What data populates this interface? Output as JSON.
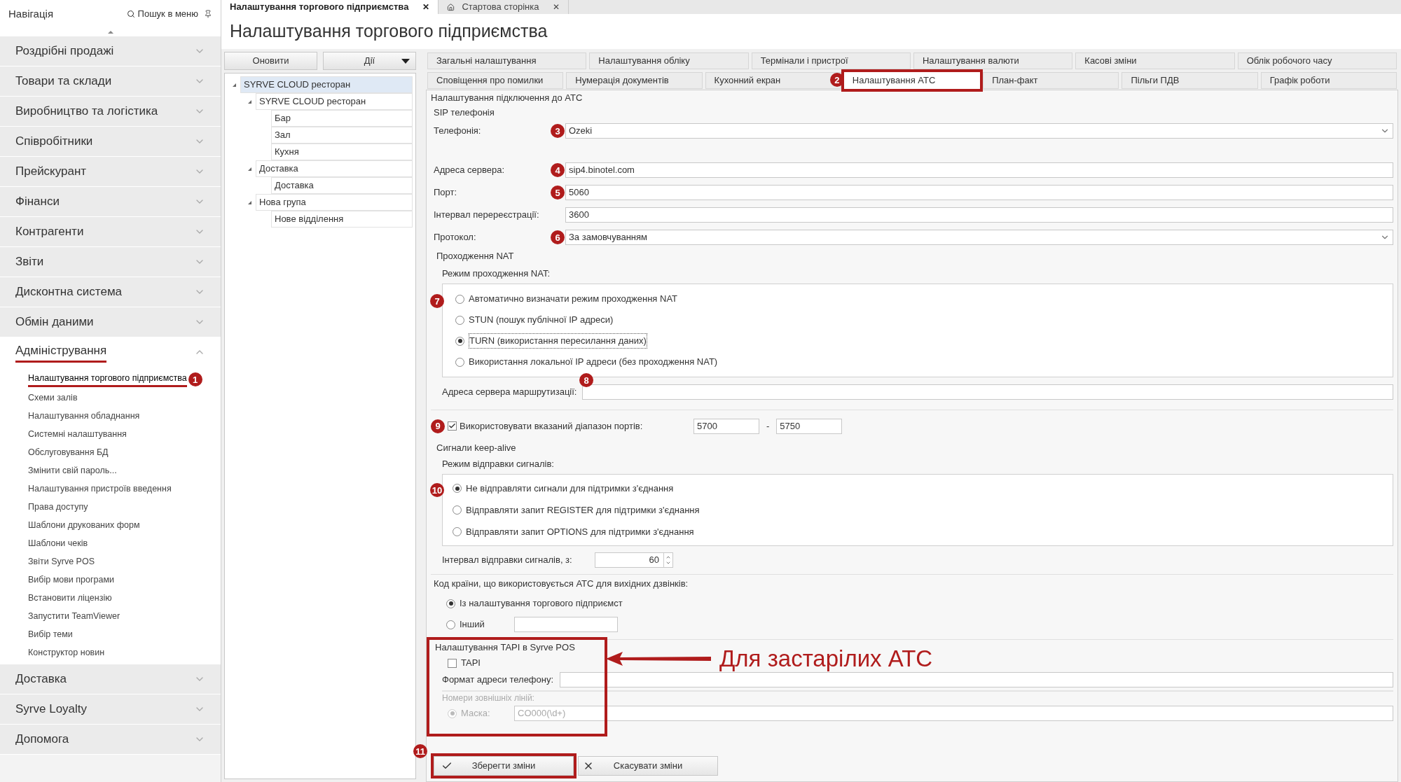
{
  "document_tabs": [
    {
      "label": "Налаштування торгового підприємства",
      "selected": true,
      "close": "✕"
    },
    {
      "label": "Стартова сторінка",
      "selected": false,
      "close": "✕"
    }
  ],
  "navigation": {
    "title": "Навігація",
    "search": "Пошук в меню",
    "sections": [
      {
        "label": "Роздрібні продажі",
        "expanded": false
      },
      {
        "label": "Товари та склади",
        "expanded": false
      },
      {
        "label": "Виробництво та логістика",
        "expanded": false
      },
      {
        "label": "Співробітники",
        "expanded": false
      },
      {
        "label": "Прейскурант",
        "expanded": false
      },
      {
        "label": "Фінанси",
        "expanded": false
      },
      {
        "label": "Контрагенти",
        "expanded": false
      },
      {
        "label": "Звіти",
        "expanded": false
      },
      {
        "label": "Дисконтна система",
        "expanded": false
      },
      {
        "label": "Обмін даними",
        "expanded": false
      },
      {
        "label": "Адміністрування",
        "expanded": true,
        "underlined": true,
        "children": [
          {
            "label": "Налаштування торгового підприємства",
            "selected": true,
            "underlined": true,
            "badge": "1"
          },
          {
            "label": "Схеми залів",
            "selected": false
          },
          {
            "label": "Налаштування обладнання",
            "selected": false
          },
          {
            "label": "Системні налаштування",
            "selected": false
          },
          {
            "label": "Обслуговування БД",
            "selected": false
          },
          {
            "label": "Змінити свій пароль...",
            "selected": false
          },
          {
            "label": "Налаштування пристроїв введення",
            "selected": false
          },
          {
            "label": "Права доступу",
            "selected": false
          },
          {
            "label": "Шаблони друкованих форм",
            "selected": false
          },
          {
            "label": "Шаблони чеків",
            "selected": false
          },
          {
            "label": "Звіти Syrve POS",
            "selected": false
          },
          {
            "label": "Вибір мови програми",
            "selected": false
          },
          {
            "label": "Встановити ліцензію",
            "selected": false
          },
          {
            "label": "Запустити TeamViewer",
            "selected": false
          },
          {
            "label": "Вибір теми",
            "selected": false
          },
          {
            "label": "Конструктор новин",
            "selected": false
          }
        ]
      },
      {
        "label": "Доставка",
        "expanded": false
      },
      {
        "label": "Syrve Loyalty",
        "expanded": false
      },
      {
        "label": "Допомога",
        "expanded": false
      }
    ]
  },
  "page_title": "Налаштування торгового підприємства",
  "tree_panel": {
    "buttons": [
      {
        "label": "Оновити",
        "kind": "plain"
      },
      {
        "label": "Дії",
        "kind": "dropdown"
      }
    ],
    "tree": [
      {
        "label": "SYRVE CLOUD ресторан",
        "selected": true,
        "children": [
          {
            "label": "SYRVE CLOUD ресторан",
            "selected": false,
            "children": [
              {
                "label": "Бар",
                "selected": false
              },
              {
                "label": "Зал",
                "selected": false
              },
              {
                "label": "Кухня",
                "selected": false
              }
            ]
          },
          {
            "label": "Доставка",
            "selected": false,
            "children": [
              {
                "label": "Доставка",
                "selected": false
              }
            ]
          },
          {
            "label": "Нова група",
            "selected": false,
            "children": [
              {
                "label": "Нове відділення",
                "selected": false
              }
            ]
          }
        ]
      }
    ]
  },
  "settings_tabs": [
    [
      {
        "label": "Загальні налаштування",
        "selected": false
      },
      {
        "label": "Налаштування обліку",
        "selected": false
      },
      {
        "label": "Термінали і пристрої",
        "selected": false
      },
      {
        "label": "Налаштування валюти",
        "selected": false
      },
      {
        "label": "Касові зміни",
        "selected": false
      },
      {
        "label": "Облік робочого часу",
        "selected": false
      }
    ],
    [
      {
        "label": "Сповіщення про помилки",
        "selected": false
      },
      {
        "label": "Нумерація документів",
        "selected": false
      },
      {
        "label": "Кухонний екран",
        "selected": false
      },
      {
        "label": "Налаштування АТС",
        "selected": true,
        "highlighted": true,
        "badge": "2"
      },
      {
        "label": "План-факт",
        "selected": false
      },
      {
        "label": "Пільги ПДВ",
        "selected": false
      },
      {
        "label": "Графік роботи",
        "selected": false
      }
    ]
  ],
  "connection": {
    "title": "Налаштування підключення до АТС",
    "sip_title": "SIP телефонія",
    "fields": [
      {
        "label": "Телефонія:",
        "value": "Ozeki",
        "kind": "select",
        "badge": "3"
      },
      {
        "label": "Адреса сервера:",
        "value": "sip4.binotel.com",
        "kind": "text",
        "badge": "4"
      },
      {
        "label": "Порт:",
        "value": "5060",
        "kind": "text",
        "badge": "5"
      },
      {
        "label": "Інтервал перереєстрації:",
        "value": "3600",
        "kind": "text"
      },
      {
        "label": "Протокол:",
        "value": "За замовчуванням",
        "kind": "select",
        "badge": "6"
      }
    ],
    "nat": {
      "title": "Проходження NAT",
      "mode_label": "Режим проходження NAT:",
      "badge": "7",
      "options": [
        {
          "label": "Автоматично визначати режим проходження NAT",
          "selected": false
        },
        {
          "label": "STUN (пошук публічної IP адреси)",
          "selected": false
        },
        {
          "label": "TURN (використання пересилання даних)",
          "selected": true
        },
        {
          "label": "Використання локальної IP адреси (без проходження NAT)",
          "selected": false
        }
      ],
      "routing_label": "Адреса сервера маршрутизації:",
      "routing_badge": "8"
    },
    "port_range": {
      "label": "Використовувати вказаний діапазон портів:",
      "checked": true,
      "badge": "9",
      "from": "5700",
      "separator": "-",
      "to": "5750"
    },
    "keepalive": {
      "title": "Сигнали keep-alive",
      "mode_label": "Режим відправки сигналів:",
      "badge": "10",
      "options": [
        {
          "label": "Не відправляти сигнали для підтримки з'єднання",
          "selected": true
        },
        {
          "label": "Відправляти запит REGISTER для підтримки з'єднання",
          "selected": false
        },
        {
          "label": "Відправляти запит OPTIONS для підтримки з'єднання",
          "selected": false
        }
      ],
      "interval_label": "Інтервал відправки сигналів, з:",
      "interval_value": "60"
    },
    "country_code": {
      "label": "Код країни, що використовується АТС для вихідних дзвінків:",
      "options": [
        {
          "label": "Із налаштування торгового підприємст",
          "selected": true
        },
        {
          "label": "Інший",
          "selected": false
        }
      ]
    },
    "tapi": {
      "title": "Налаштування TAPI в Syrve POS",
      "highlighted": true,
      "checkbox_label": "TAPI",
      "checked": false,
      "format_label": "Формат адреси телефону:",
      "external_lines": {
        "title": "Номери зовнішніх ліній:",
        "disabled": true,
        "option_label": "Маска:",
        "option_selected": true,
        "value": "CO000(\\d+)"
      }
    },
    "callout": "Для застарілих АТС"
  },
  "actions": [
    {
      "label": "Зберегти зміни",
      "kind": "save",
      "highlighted": true,
      "badge": "11"
    },
    {
      "label": "Скасувати зміни",
      "kind": "cancel",
      "highlighted": false
    }
  ]
}
